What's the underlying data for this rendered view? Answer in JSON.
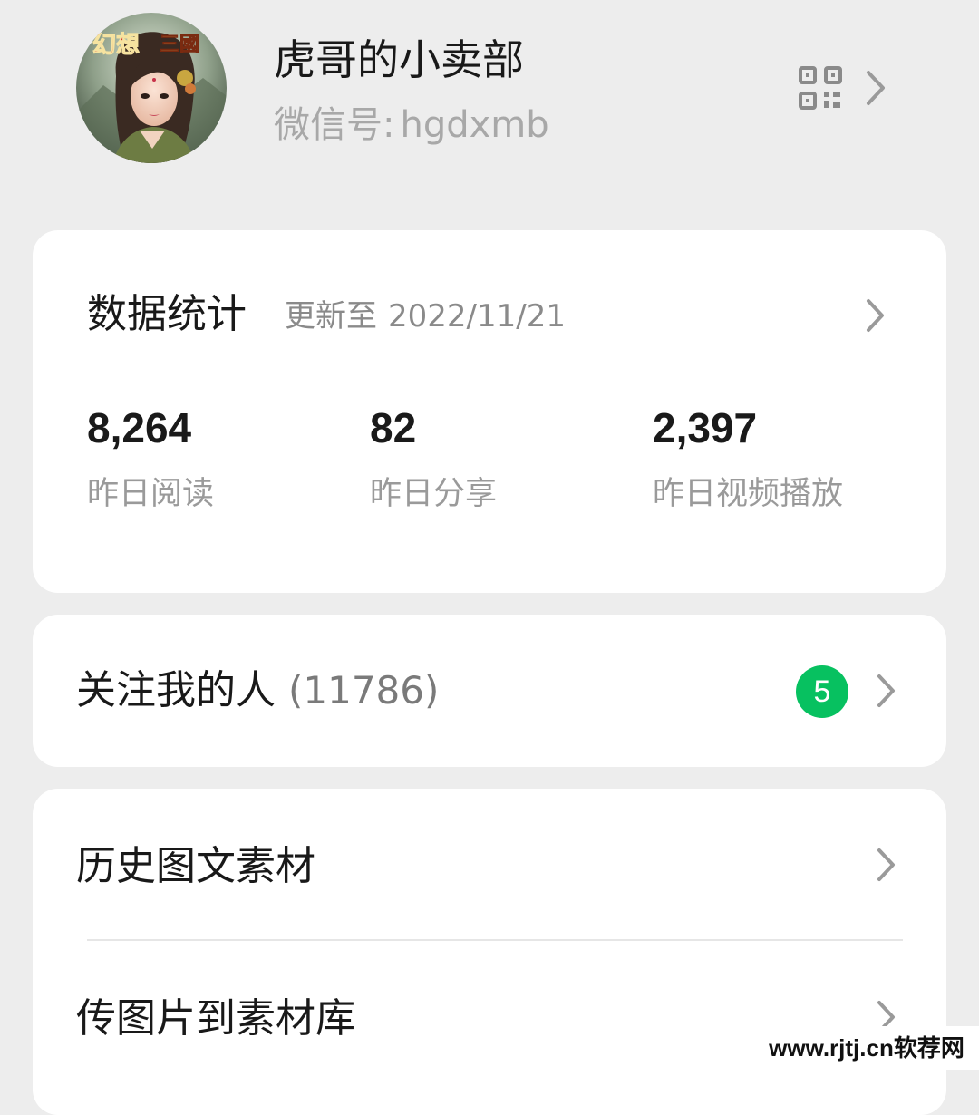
{
  "profile": {
    "name": "虎哥的小卖部",
    "wechat_label": "微信号:",
    "wechat_id": "hgdxmb",
    "avatar_caption": "幻想三國",
    "qr_icon": "qr-code-icon",
    "arrow_icon": "chevron-right-icon"
  },
  "stats": {
    "title": "数据统计",
    "updated_label": "更新至",
    "updated_date": "2022/11/21",
    "metrics": [
      {
        "value": "8,264",
        "label": "昨日阅读"
      },
      {
        "value": "82",
        "label": "昨日分享"
      },
      {
        "value": "2,397",
        "label": "昨日视频播放"
      }
    ]
  },
  "followers": {
    "label": "关注我的人",
    "count": "(11786)",
    "badge": "5",
    "badge_color": "#07c160"
  },
  "materials": {
    "items": [
      {
        "label": "历史图文素材"
      },
      {
        "label": "传图片到素材库"
      }
    ]
  },
  "watermark": "www.rjtj.cn软荐网",
  "colors": {
    "background": "#ededed",
    "card": "#ffffff",
    "accent_green": "#07c160"
  }
}
